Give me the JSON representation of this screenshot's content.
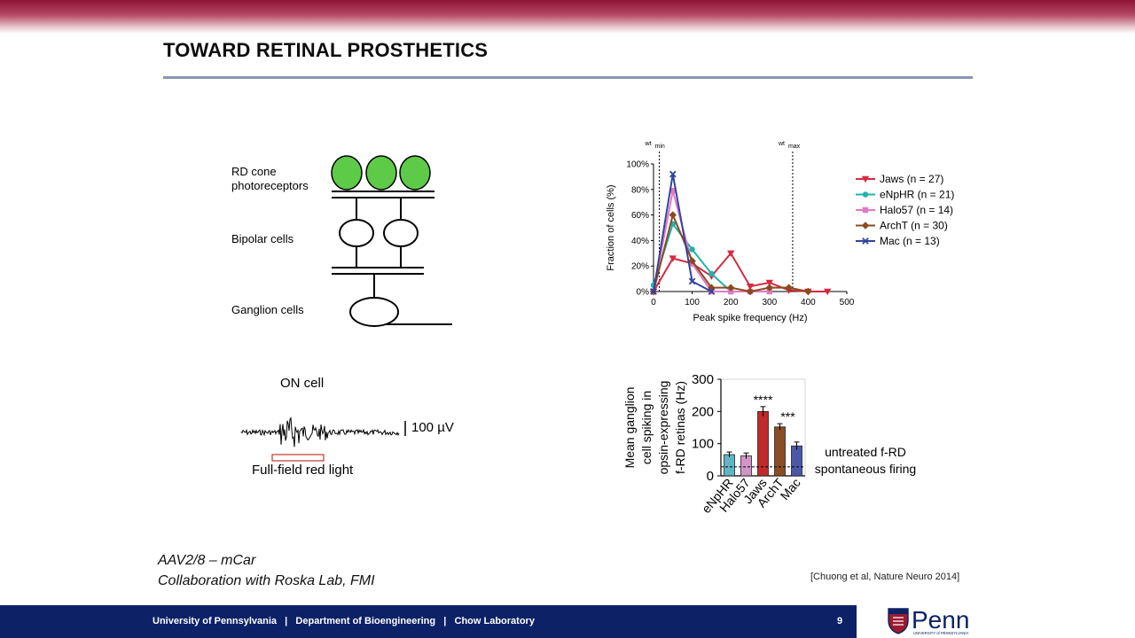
{
  "slide": {
    "title": "TOWARD RETINAL PROSTHETICS",
    "notes": [
      "AAV2/8 – mCar",
      "Collaboration with Roska Lab, FMI"
    ],
    "citation": "[Chuong et al, Nature Neuro 2014]",
    "page_number": "9",
    "footer_text": "University of Pennsylvania   |   Department of Bioengineering   |   Chow Laboratory",
    "logo_text": "Penn",
    "logo_subtext": "UNIVERSITY of PENNSYLVANIA"
  },
  "diagram": {
    "labels": [
      "RD cone\nphotoreceptors",
      "Bipolar cells",
      "Ganglion cells"
    ],
    "cone_color": "#5ecb48"
  },
  "trace": {
    "title": "ON cell",
    "scale_label": "100 µV",
    "stimulus_label": "Full-field red light",
    "stimulus_color": "#c0392b"
  },
  "chart_data": [
    {
      "type": "line",
      "xlabel": "Peak spike frequency (Hz)",
      "ylabel": "Fraction of cells (%)",
      "xlim": [
        0,
        500
      ],
      "ylim": [
        0,
        100
      ],
      "xticks": [
        "0",
        "100",
        "200",
        "300",
        "400",
        "500"
      ],
      "yticks": [
        "0%",
        "20%",
        "40%",
        "60%",
        "80%",
        "100%"
      ],
      "annotations": [
        {
          "text": "wt",
          "sub": "min",
          "x": 15
        },
        {
          "text": "wt",
          "sub": "max",
          "x": 360
        }
      ],
      "legend_position": "right",
      "series": [
        {
          "name": "Jaws (n = 27)",
          "color": "#d42a42",
          "marker": "triangle-down",
          "x": [
            0,
            50,
            100,
            150,
            200,
            250,
            300,
            350,
            400,
            450
          ],
          "y": [
            0,
            26,
            22,
            12,
            30,
            4,
            7,
            1,
            0,
            0
          ]
        },
        {
          "name": "eNpHR (n = 21)",
          "color": "#1fb3ad",
          "marker": "circle",
          "x": [
            0,
            50,
            100,
            150,
            200,
            250,
            300
          ],
          "y": [
            5,
            53,
            33,
            14,
            0,
            0,
            0
          ]
        },
        {
          "name": "Halo57 (n = 14)",
          "color": "#e07ac3",
          "marker": "square",
          "x": [
            0,
            50,
            100,
            150,
            200,
            250,
            300
          ],
          "y": [
            0,
            79,
            22,
            0,
            0,
            0,
            0
          ]
        },
        {
          "name": "ArchT (n = 30)",
          "color": "#8b4a1d",
          "marker": "diamond",
          "x": [
            0,
            50,
            100,
            150,
            200,
            250,
            300,
            350,
            400
          ],
          "y": [
            0,
            60,
            24,
            3,
            3,
            0,
            3,
            3,
            0
          ]
        },
        {
          "name": "Mac (n = 13)",
          "color": "#34439e",
          "marker": "x",
          "x": [
            0,
            50,
            100,
            150
          ],
          "y": [
            0,
            92,
            8,
            0
          ]
        }
      ]
    },
    {
      "type": "bar",
      "categories": [
        "eNpHR",
        "Halo57",
        "Jaws",
        "ArchT",
        "Mac"
      ],
      "values": [
        66,
        62,
        200,
        152,
        93
      ],
      "errors": [
        8,
        9,
        15,
        10,
        12
      ],
      "colors": [
        "#5fb5c4",
        "#d394c7",
        "#c12a2a",
        "#8b4d26",
        "#4c58a6"
      ],
      "ylabel": "Mean ganglion cell spiking in opsin-expressing f-RD retinas (Hz)",
      "ylim": [
        0,
        300
      ],
      "yticks": [
        "0",
        "100",
        "200",
        "300"
      ],
      "significance": [
        {
          "category": "Jaws",
          "text": "****"
        },
        {
          "category": "ArchT",
          "text": "***"
        }
      ],
      "reference_line": {
        "y": 28,
        "label": "untreated f-RD\nspontaneous firing"
      }
    }
  ]
}
